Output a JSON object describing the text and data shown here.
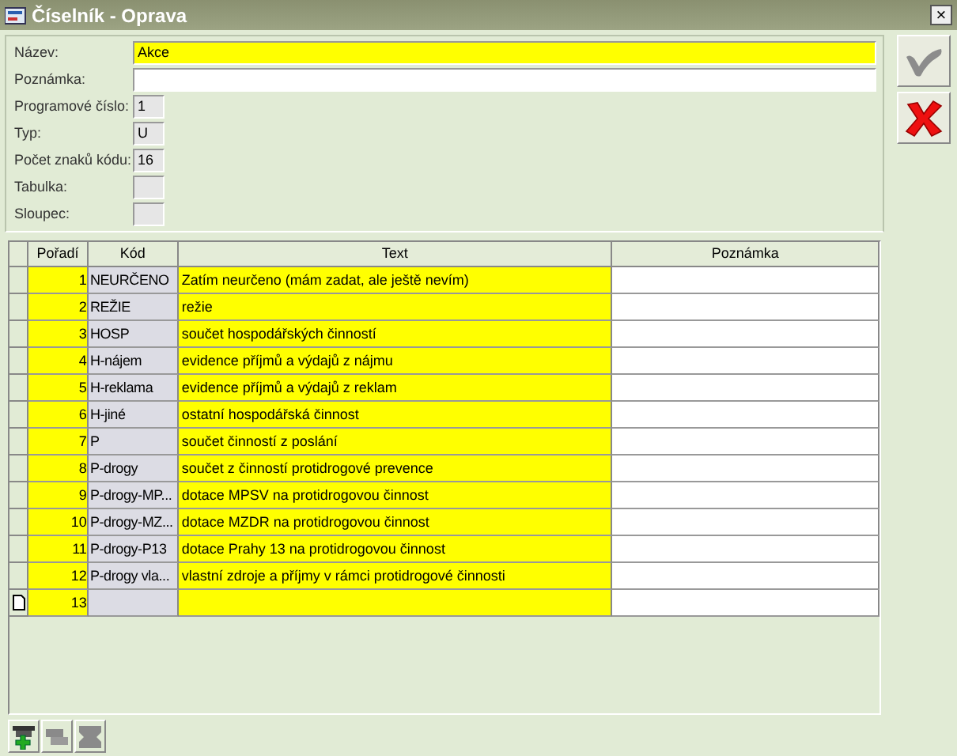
{
  "window": {
    "title": "Číselník - Oprava",
    "close": "×"
  },
  "form": {
    "fields": [
      {
        "label": "Název:",
        "value": "Akce",
        "kind": "required"
      },
      {
        "label": "Poznámka:",
        "kind": "editable"
      },
      {
        "label": "Programové číslo:",
        "value": "1",
        "kind": "readonly"
      },
      {
        "label": "Typ:",
        "value": "U",
        "kind": "readonly"
      },
      {
        "label": "Počet znaků kódu:",
        "value": "16",
        "kind": "readonly"
      },
      {
        "label": "Tabulka:",
        "kind": "readonly"
      },
      {
        "label": "Sloupec:",
        "kind": "readonly"
      }
    ]
  },
  "actions": [
    {
      "kind": "confirm",
      "disabled": true
    },
    {
      "kind": "cancel",
      "disabled": false
    }
  ],
  "table": {
    "columns": [
      "Pořadí",
      "Kód",
      "Text",
      "Poznámka"
    ],
    "rows": [
      {
        "cells": [
          "1",
          "NEURČENO",
          "Zatím neurčeno (mám zadat, ale ještě nevím)",
          null
        ],
        "current": false
      },
      {
        "cells": [
          "2",
          "REŽIE",
          "režie",
          null
        ],
        "current": false
      },
      {
        "cells": [
          "3",
          "HOSP",
          "součet hospodářských činností",
          null
        ],
        "current": false
      },
      {
        "cells": [
          "4",
          "H-nájem",
          "evidence příjmů a výdajů z nájmu",
          null
        ],
        "current": false
      },
      {
        "cells": [
          "5",
          "H-reklama",
          "evidence příjmů a výdajů z reklam",
          null
        ],
        "current": false
      },
      {
        "cells": [
          "6",
          "H-jiné",
          "ostatní hospodářská činnost",
          null
        ],
        "current": false
      },
      {
        "cells": [
          "7",
          "P",
          "součet činností z poslání",
          null
        ],
        "current": false
      },
      {
        "cells": [
          "8",
          "P-drogy",
          "součet z činností protidrogové prevence",
          null
        ],
        "current": false
      },
      {
        "cells": [
          "9",
          "P-drogy-MP...",
          "dotace MPSV na protidrogovou činnost",
          null
        ],
        "current": false
      },
      {
        "cells": [
          "10",
          "P-drogy-MZ...",
          "dotace MZDR na protidrogovou činnost",
          null
        ],
        "current": false
      },
      {
        "cells": [
          "11",
          "P-drogy-P13",
          "dotace Prahy 13 na protidrogovou činnost",
          null
        ],
        "current": false
      },
      {
        "cells": [
          "12",
          "P-drogy vla...",
          "vlastní zdroje a příjmy v rámci protidrogové činnosti",
          null
        ],
        "current": false
      },
      {
        "cells": [
          "13",
          null,
          null,
          null
        ],
        "current": true
      }
    ]
  },
  "toolbar": [
    {
      "kind": "add",
      "disabled": false
    },
    {
      "kind": "copy",
      "disabled": true
    },
    {
      "kind": "delete",
      "disabled": true
    }
  ]
}
